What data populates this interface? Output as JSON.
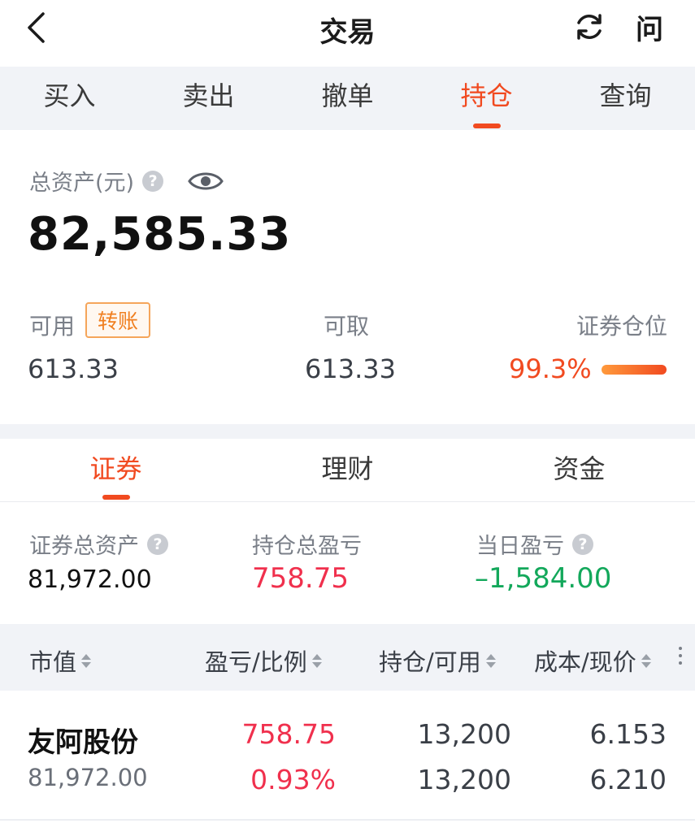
{
  "header": {
    "title": "交易",
    "ask_label": "问"
  },
  "trade_tabs": [
    {
      "label": "买入"
    },
    {
      "label": "卖出"
    },
    {
      "label": "撤单"
    },
    {
      "label": "持仓"
    },
    {
      "label": "查询"
    }
  ],
  "summary": {
    "total_asset_label": "总资产(元)",
    "total_asset_value": "82,585.33",
    "available_label": "可用",
    "transfer_label": "转账",
    "available_value": "613.33",
    "withdrawable_label": "可取",
    "withdrawable_value": "613.33",
    "position_label": "证券仓位",
    "position_value": "99.3%",
    "position_ratio": 0.993
  },
  "sub_tabs": [
    {
      "label": "证券"
    },
    {
      "label": "理财"
    },
    {
      "label": "资金"
    }
  ],
  "stats": {
    "securities_total_label": "证券总资产",
    "securities_total_value": "81,972.00",
    "holding_pnl_label": "持仓总盈亏",
    "holding_pnl_value": "758.75",
    "daily_pnl_label": "当日盈亏",
    "daily_pnl_value": "–1,584.00"
  },
  "table": {
    "columns": [
      "市值",
      "盈亏/比例",
      "持仓/可用",
      "成本/现价"
    ],
    "rows": [
      {
        "name": "友阿股份",
        "market_value": "81,972.00",
        "pnl": "758.75",
        "pnl_pct": "0.93%",
        "holding": "13,200",
        "available": "13,200",
        "cost": "6.153",
        "price": "6.210"
      }
    ]
  },
  "colors": {
    "accent": "#f14a20",
    "profit": "#f0304d",
    "loss": "#13a85b",
    "tab_bg": "#f1f3f7"
  }
}
